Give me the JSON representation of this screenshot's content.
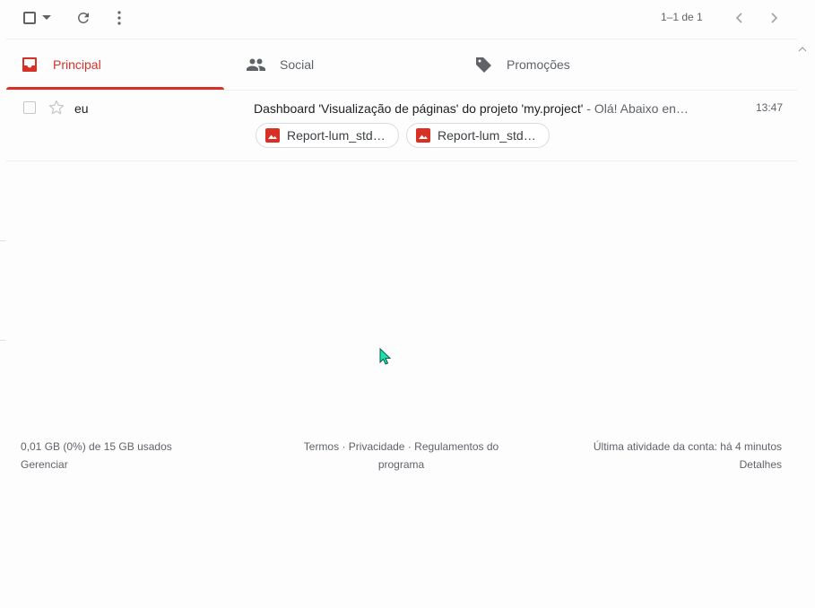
{
  "toolbar": {
    "pager": "1–1 de 1"
  },
  "tabs": [
    {
      "label": "Principal",
      "icon": "inbox-icon",
      "active": true
    },
    {
      "label": "Social",
      "icon": "people-icon",
      "active": false
    },
    {
      "label": "Promoções",
      "icon": "tag-icon",
      "active": false
    }
  ],
  "email": {
    "sender": "eu",
    "subject": "Dashboard 'Visualização de páginas' do projeto 'my.project'",
    "snippet": " - Olá! Abaixo en…",
    "time": "13:47",
    "attachments": [
      {
        "label": "Report-lum_std…",
        "icon": "image-icon"
      },
      {
        "label": "Report-lum_std…",
        "icon": "image-icon"
      }
    ]
  },
  "footer": {
    "storage": "0,01 GB (0%) de 15 GB usados",
    "manage": "Gerenciar",
    "terms": "Termos",
    "privacy": "Privacidade",
    "program_policies": "Regulamentos do programa",
    "last_activity": "Última atividade da conta: há 4 minutos",
    "details": "Detalhes"
  },
  "colors": {
    "accent": "#d93025",
    "cursor": "#19e3b1"
  }
}
